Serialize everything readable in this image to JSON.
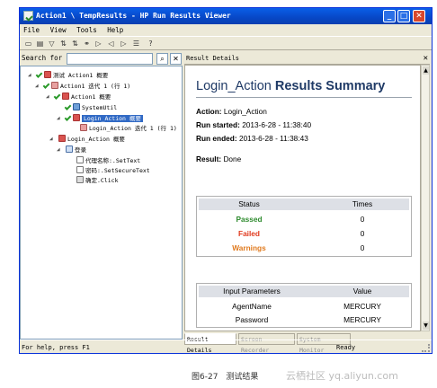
{
  "window": {
    "title": "Action1 \\ TempResults - HP Run Results Viewer",
    "minimize": "_",
    "maximize": "□",
    "close": "✕"
  },
  "menu": [
    "File",
    "View",
    "Tools",
    "Help"
  ],
  "search": {
    "label": "Search for",
    "value": "",
    "go": "⌕",
    "clear": "✕"
  },
  "tree": [
    {
      "label": "测试 Action1 概要",
      "icon": "action",
      "status": "passed"
    },
    {
      "label": "Action1 迭代 1 (行 1)",
      "icon": "iter",
      "status": "passed"
    },
    {
      "label": "Action1 概要",
      "icon": "action",
      "status": "passed"
    },
    {
      "label": "SystemUtil",
      "icon": "sys",
      "status": "passed"
    },
    {
      "label": "Login_Action 概要",
      "icon": "action",
      "status": "passed",
      "selected": true
    },
    {
      "label": "Login_Action 迭代 1 (行 1)",
      "icon": "iter",
      "status": "none"
    },
    {
      "label": "Login_Action 概要",
      "icon": "action",
      "status": "none"
    },
    {
      "label": "登录",
      "icon": "page",
      "status": "none"
    },
    {
      "label": "代理名称:.SetText",
      "icon": "edit",
      "status": "none"
    },
    {
      "label": "密码:.SetSecureText",
      "icon": "edit",
      "status": "none"
    },
    {
      "label": "确定.Click",
      "icon": "btn",
      "status": "none"
    }
  ],
  "result_pane": {
    "header": "Result Details",
    "close": "✕",
    "title_regular": "Login_Action",
    "title_bold": "Results Summary",
    "action_label": "Action:",
    "action_value": "Login_Action",
    "run_started_label": "Run started:",
    "run_started_value": "2013-6-28 - 11:38:40",
    "run_ended_label": "Run ended:",
    "run_ended_value": "2013-6-28 - 11:38:43",
    "result_label": "Result:",
    "result_value": "Done"
  },
  "status_table": {
    "headers": [
      "Status",
      "Times"
    ],
    "rows": [
      {
        "status": "Passed",
        "times": "0",
        "color": "#2e8b2e"
      },
      {
        "status": "Failed",
        "times": "0",
        "color": "#e03a1e"
      },
      {
        "status": "Warnings",
        "times": "0",
        "color": "#e07a1e"
      }
    ]
  },
  "params_table": {
    "headers": [
      "Input Parameters",
      "Value"
    ],
    "rows": [
      {
        "name": "AgentName",
        "value": "MERCURY"
      },
      {
        "name": "Password",
        "value": "MERCURY"
      }
    ]
  },
  "bottom_tabs": [
    "Result Details",
    "Screen Recorder",
    "System Monitor"
  ],
  "statusbar": {
    "help": "For help, press F1",
    "ready": "Ready"
  },
  "caption": {
    "figure": "图6-27　测试结果",
    "watermark": "云栖社区 yq.aliyun.com"
  }
}
